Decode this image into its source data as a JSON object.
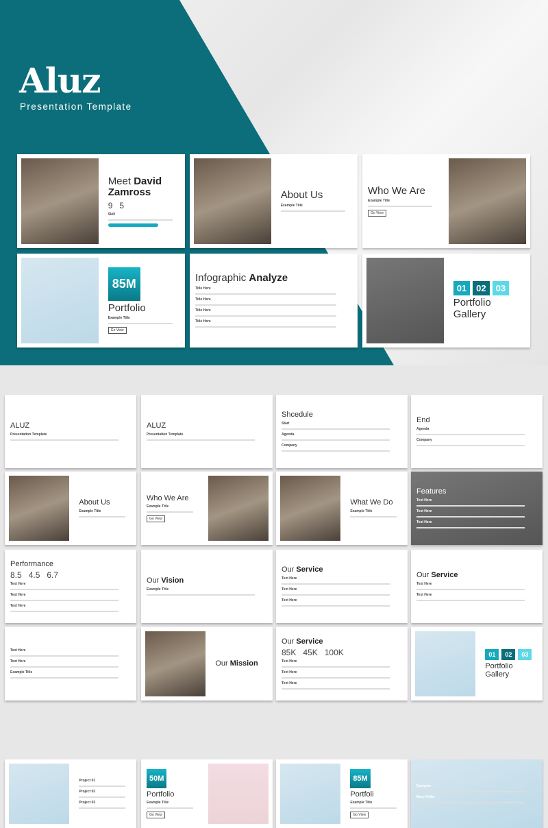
{
  "hero": {
    "brand": "Aluz",
    "tagline": "Presentation Template",
    "accent": "#0b6e7a"
  },
  "slides": [
    {
      "title": "Meet",
      "title_bold": "David",
      "title2": "Zamross",
      "labels": [
        "Skill"
      ],
      "stats": [
        "9",
        "5"
      ]
    },
    {
      "title": "About Us",
      "labels": [
        "Example Title"
      ]
    },
    {
      "title": "Who We Are",
      "labels": [
        "Example Title"
      ],
      "button": "Go View"
    },
    {
      "stat": "85M",
      "labels": [
        "Example Title"
      ],
      "button": "Go View",
      "title": "Portfolio"
    },
    {
      "title": "Infographic",
      "title_bold": "Analyze",
      "labels": [
        "Title Here",
        "Title Here",
        "Title Here",
        "Title Here"
      ]
    },
    {
      "badges": [
        "01",
        "02",
        "03"
      ],
      "title": "Portfolio Gallery"
    },
    {
      "title": "ALUZ",
      "labels": [
        "Presentation Template"
      ]
    },
    {
      "title": "ALUZ",
      "labels": [
        "Presentation Template"
      ]
    },
    {
      "title": "Shcedule",
      "labels": [
        "Start",
        "Agenda",
        "Company"
      ]
    },
    {
      "title": "End",
      "labels": [
        "Agenda",
        "Company"
      ]
    },
    {
      "title": "About Us",
      "labels": [
        "Example Title"
      ]
    },
    {
      "title": "Who We Are",
      "labels": [
        "Example Title"
      ],
      "button": "Go View"
    },
    {
      "title": "What We Do",
      "labels": [
        "Example Title"
      ]
    },
    {
      "title": "Features",
      "labels": [
        "Text Here",
        "Text Here",
        "Text Here"
      ]
    },
    {
      "stats": [
        "8.5",
        "4.5",
        "6.7"
      ],
      "labels": [
        "Text Here",
        "Text Here",
        "Text Here"
      ],
      "title": "Performance"
    },
    {
      "title": "Our",
      "title_bold": "Vision",
      "labels": [
        "Example Title"
      ]
    },
    {
      "title": "Our",
      "title_bold": "Service",
      "labels": [
        "Text Here",
        "Text Here",
        "Text Here"
      ]
    },
    {
      "title": "Our",
      "title_bold": "Service",
      "labels": [
        "Text Here",
        "Text Here"
      ]
    },
    {
      "labels": [
        "Text Here",
        "Text Here",
        "Example Title"
      ]
    },
    {
      "title": "Our",
      "title_bold": "Mission"
    },
    {
      "title": "Our",
      "title_bold": "Service",
      "stats": [
        "85K",
        "45K",
        "100K"
      ],
      "labels": [
        "Text Here",
        "Text Here",
        "Text Here"
      ]
    },
    {
      "badges": [
        "01",
        "02",
        "03"
      ],
      "title": "Portfolio Gallery"
    },
    {
      "labels": [
        "Project 01",
        "Project 02",
        "Project 03"
      ]
    },
    {
      "title": "Portfolio",
      "stat": "50M",
      "labels": [
        "Example Title"
      ],
      "button": "Go View"
    },
    {
      "stat": "85M",
      "labels": [
        "Example Title"
      ],
      "button": "Go View",
      "title": "Portfoli"
    },
    {
      "labels": [
        "Designer",
        "Mary Keller"
      ]
    }
  ]
}
